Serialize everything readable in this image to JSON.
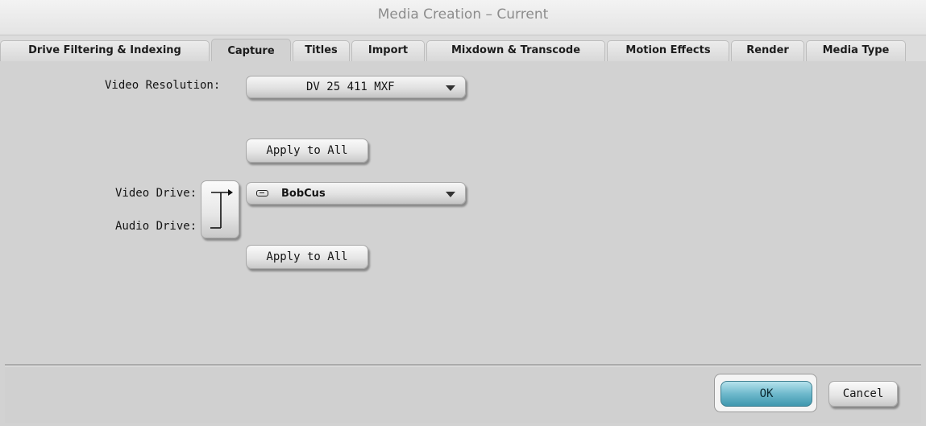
{
  "window": {
    "title": "Media Creation – Current"
  },
  "tabs": [
    {
      "label": "Drive Filtering & Indexing",
      "active": false
    },
    {
      "label": "Capture",
      "active": true
    },
    {
      "label": "Titles",
      "active": false
    },
    {
      "label": "Import",
      "active": false
    },
    {
      "label": "Mixdown & Transcode",
      "active": false
    },
    {
      "label": "Motion Effects",
      "active": false
    },
    {
      "label": "Render",
      "active": false
    },
    {
      "label": "Media Type",
      "active": false
    }
  ],
  "capture": {
    "video_resolution_label": "Video Resolution:",
    "video_resolution_value": "DV 25 411  MXF",
    "apply_to_all_resolution": "Apply to All",
    "video_drive_label": "Video Drive:",
    "audio_drive_label": "Audio Drive:",
    "drive_value": "BobCus",
    "apply_to_all_drive": "Apply to All"
  },
  "footer": {
    "ok_label": "OK",
    "cancel_label": "Cancel"
  },
  "colors": {
    "background": "#d2d2d2",
    "ok_button": "#6fb9cc",
    "title_text": "#8c8c8c"
  },
  "icons": {
    "drive": "drive-icon",
    "link_drives": "link-drives-icon",
    "dropdown_arrow": "chevron-down-icon"
  }
}
